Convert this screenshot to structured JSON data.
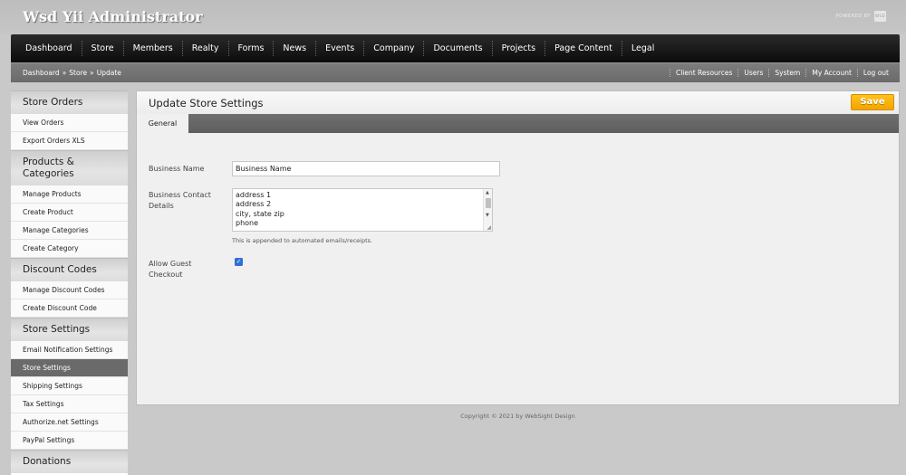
{
  "header": {
    "title": "Wsd Yii Administrator",
    "powered_by": "POWERED BY",
    "powered_logo": "WSD"
  },
  "nav": [
    "Dashboard",
    "Store",
    "Members",
    "Realty",
    "Forms",
    "News",
    "Events",
    "Company",
    "Documents",
    "Projects",
    "Page Content",
    "Legal"
  ],
  "breadcrumb": {
    "items": [
      "Dashboard",
      "Store",
      "Update"
    ],
    "separator": "»"
  },
  "utility_nav": [
    "Client Resources",
    "Users",
    "System",
    "My Account",
    "Log out"
  ],
  "sidebar": {
    "groups": [
      {
        "title": "Store Orders",
        "items": [
          "View Orders",
          "Export Orders XLS"
        ]
      },
      {
        "title": "Products & Categories",
        "items": [
          "Manage Products",
          "Create Product",
          "Manage Categories",
          "Create Category"
        ]
      },
      {
        "title": "Discount Codes",
        "items": [
          "Manage Discount Codes",
          "Create Discount Code"
        ]
      },
      {
        "title": "Store Settings",
        "items": [
          "Email Notification Settings",
          "Store Settings",
          "Shipping Settings",
          "Tax Settings",
          "Authorize.net Settings",
          "PayPal Settings"
        ]
      },
      {
        "title": "Donations",
        "items": []
      }
    ],
    "active_item": "Store Settings"
  },
  "panel": {
    "title": "Update Store Settings",
    "save_label": "Save",
    "tab_label": "General"
  },
  "form": {
    "business_name": {
      "label": "Business Name",
      "value": "Business Name"
    },
    "business_contact": {
      "label": "Business Contact Details",
      "lines": [
        "address 1",
        "address 2",
        "city, state zip",
        "phone"
      ],
      "hint": "This is appended to automated emails/receipts."
    },
    "guest_checkout": {
      "label": "Allow Guest Checkout",
      "checked": true
    }
  },
  "footer": {
    "copyright": "Copyright © 2021 by WebSight Design"
  },
  "colors": {
    "nav_bg": "#1a1a1a",
    "save_button": "#f5a800",
    "active_item": "#6a6a6a",
    "checkbox": "#2f6fd6"
  },
  "icons": {
    "scroll_up": "triangle-up-icon",
    "scroll_down": "triangle-down-icon",
    "checkbox_check": "check-icon",
    "resize": "resize-grip-icon"
  }
}
